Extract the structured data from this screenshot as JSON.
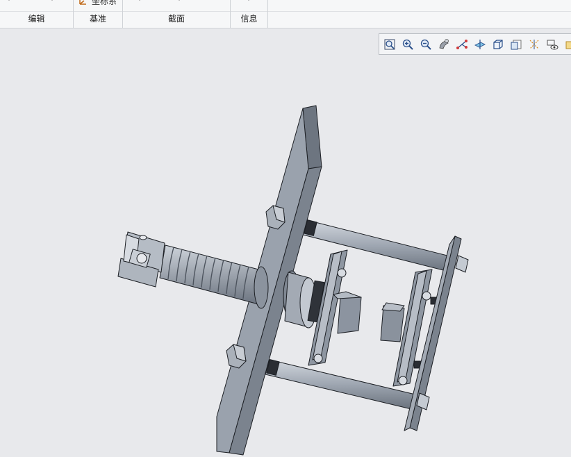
{
  "ribbon": {
    "partial_button_label": "坐标系",
    "groups": [
      {
        "label": "编辑"
      },
      {
        "label": "基准"
      },
      {
        "label": "截面"
      },
      {
        "label": "信息"
      }
    ]
  },
  "view_toolbar": {
    "buttons": [
      "refit-icon",
      "zoom-in-icon",
      "zoom-out-icon",
      "repaint-icon",
      "datum-points-icon",
      "spin-center-icon",
      "display-style-icon",
      "saved-views-icon",
      "datum-display-icon",
      "annotation-display-icon"
    ]
  },
  "colors": {
    "viewport_bg": "#e8e9ec",
    "part_face": "#9aa2ad",
    "part_dark": "#5d6570",
    "part_light": "#c3c9d1",
    "edge": "#1c1f24"
  }
}
